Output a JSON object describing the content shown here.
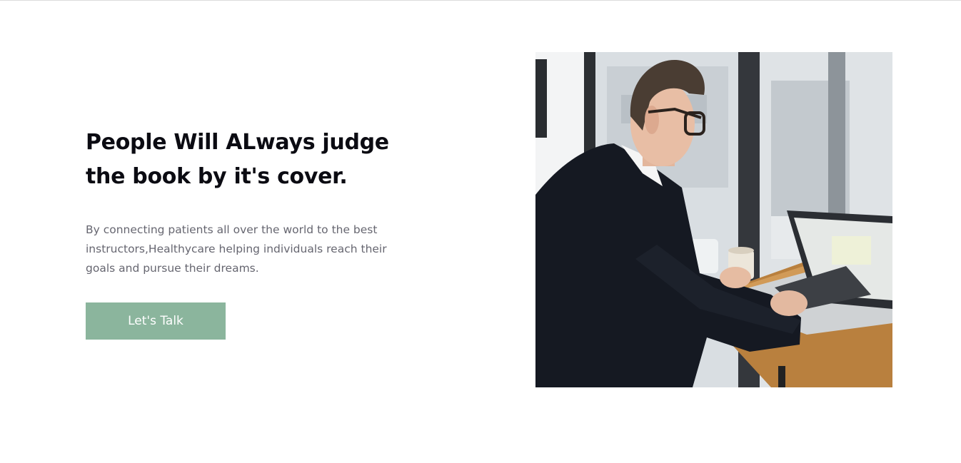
{
  "hero": {
    "headline_lines": [
      "People Will ALways judge",
      "the book by it's cover."
    ],
    "description_lines": [
      "By connecting patients all over the world to the best",
      "instructors,Healthycare helping individuals reach their",
      "goals and pursue their dreams."
    ],
    "cta_label": "Let's Talk",
    "photo_subject": "man-working-on-laptop-at-cafe-window"
  },
  "colors": {
    "cta_background": "#8bb59d",
    "headline": "#0b0b12",
    "body_text": "#666670"
  }
}
